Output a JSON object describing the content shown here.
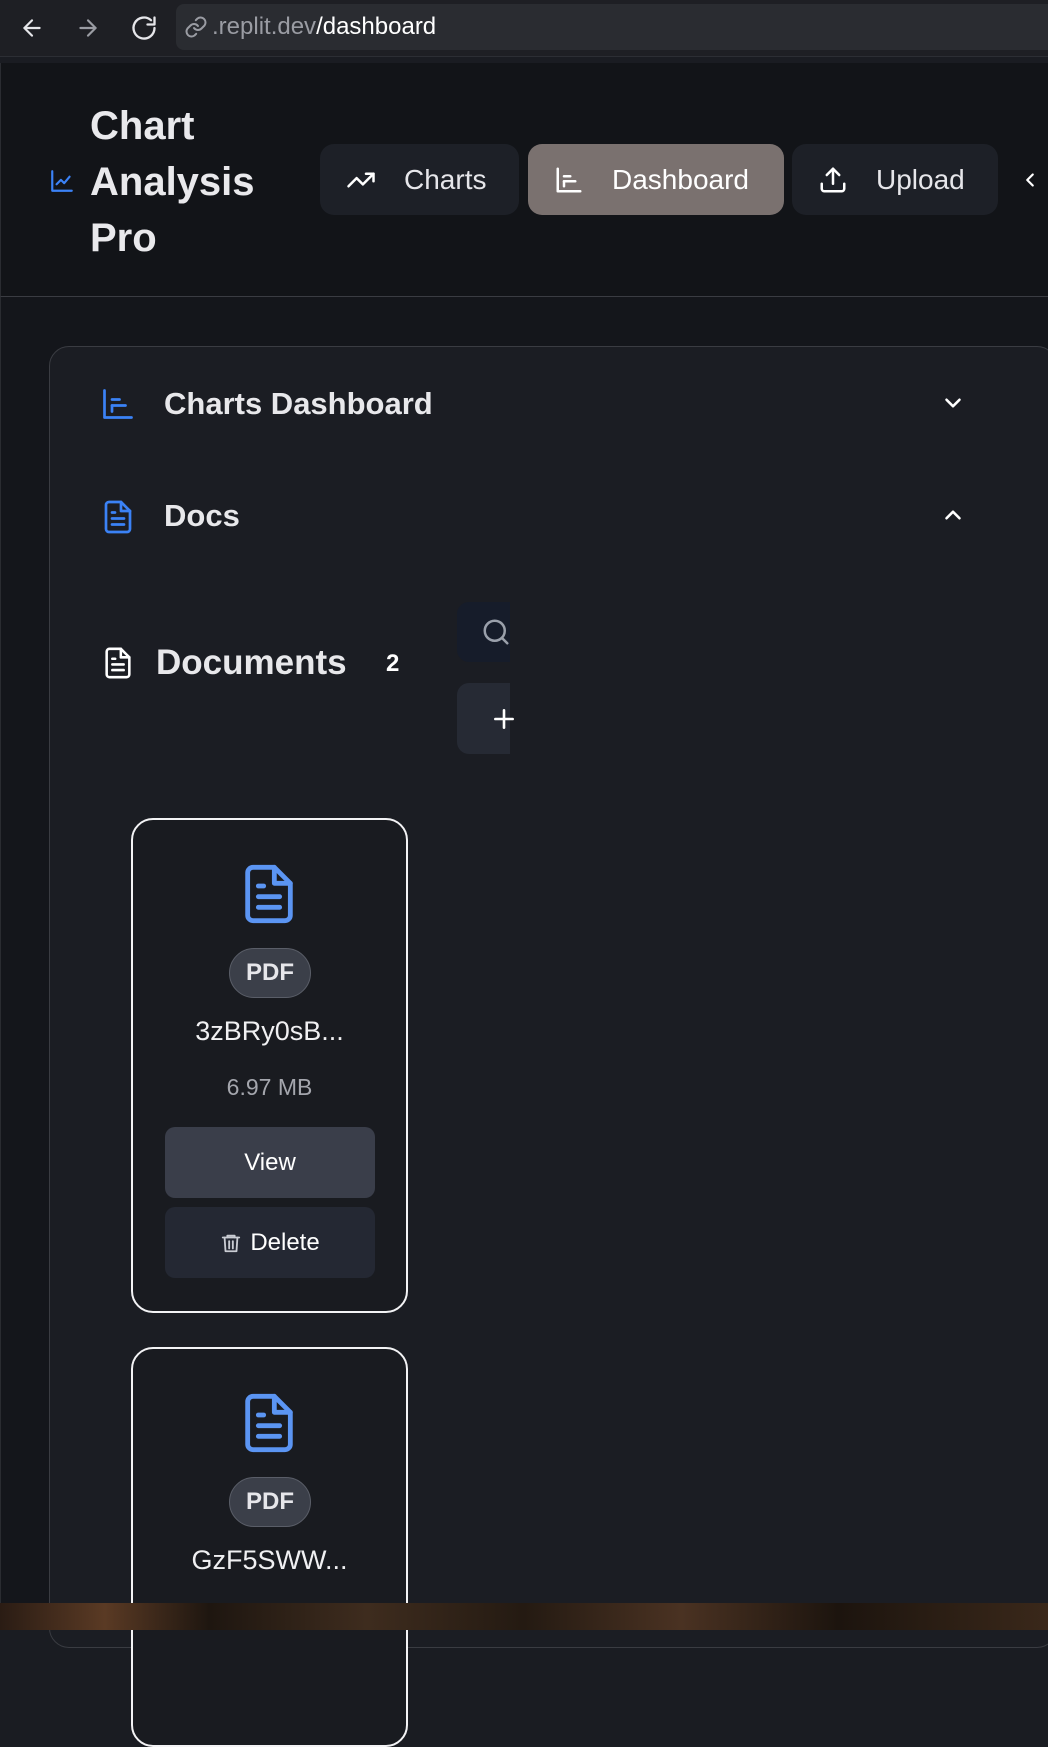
{
  "browser": {
    "url_domain": ".replit.dev",
    "url_path": "/dashboard"
  },
  "app": {
    "brand": "Chart Analysis Pro",
    "nav": [
      {
        "label": "Charts",
        "icon": "trending-up-icon",
        "active": false
      },
      {
        "label": "Dashboard",
        "icon": "bar-chart-icon",
        "active": true
      },
      {
        "label": "Upload",
        "icon": "upload-icon",
        "active": false
      }
    ]
  },
  "panel": {
    "sections": [
      {
        "label": "Charts Dashboard",
        "icon": "bar-chart-icon",
        "expanded": false
      },
      {
        "label": "Docs",
        "icon": "document-icon",
        "expanded": true
      }
    ],
    "documents": {
      "title": "Documents",
      "count": "2",
      "items": [
        {
          "type": "PDF",
          "name": "3zBRy0sB...",
          "size": "6.97 MB",
          "view_label": "View",
          "delete_label": "Delete"
        },
        {
          "type": "PDF",
          "name": "GzF5SWW..."
        }
      ]
    }
  },
  "colors": {
    "accent": "#3b82f6",
    "active_nav": "#7a716f"
  }
}
